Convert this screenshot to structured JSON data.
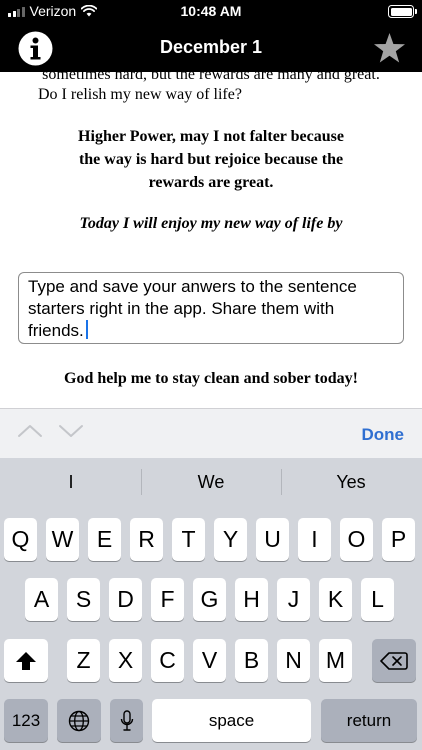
{
  "status_bar": {
    "carrier": "Verizon",
    "time": "10:48 AM"
  },
  "nav": {
    "title": "December 1",
    "info_icon": "info-circle-icon",
    "favorite_icon": "star-icon"
  },
  "reading": {
    "cut_line": "sometimes hard, but the rewards are many and great.",
    "question": "Do I relish my new way of life?",
    "prayer_lines": [
      "Higher Power, may I not falter because",
      "the way is hard but rejoice because the",
      "rewards are great."
    ],
    "sentence_starter": "Today I will enjoy my new way of life by",
    "answer": "Type and save your anwers to the sentence starters right in the app. Share them with friends.",
    "closing": "God help me to stay clean and sober today!"
  },
  "input_toolbar": {
    "done_label": "Done",
    "prev_icon": "chevron-up-icon",
    "next_icon": "chevron-down-icon"
  },
  "keyboard": {
    "suggestions": [
      "I",
      "We",
      "Yes"
    ],
    "rows": [
      [
        "Q",
        "W",
        "E",
        "R",
        "T",
        "Y",
        "U",
        "I",
        "O",
        "P"
      ],
      [
        "A",
        "S",
        "D",
        "F",
        "G",
        "H",
        "J",
        "K",
        "L"
      ],
      [
        "Z",
        "X",
        "C",
        "V",
        "B",
        "N",
        "M"
      ]
    ],
    "numbers_label": "123",
    "space_label": "space",
    "return_label": "return"
  }
}
